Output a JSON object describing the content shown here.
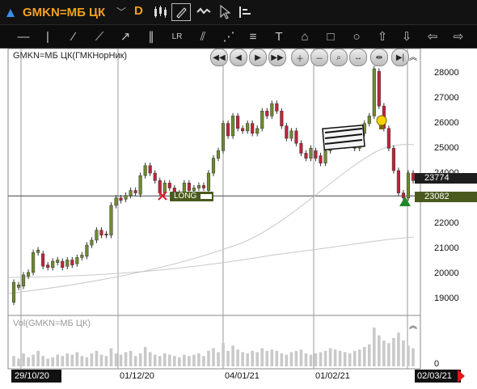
{
  "toolbar": {
    "instrument_label": "GMKN=МБ ЦК",
    "interval_label": "D"
  },
  "chart": {
    "instrument_title": "GMKN=МБ ЦК(ГМКНорНик)",
    "volume_title": "Vol(GMKN=МБ ЦК)",
    "long_label": "LONG",
    "price_tag_upper": "23774",
    "price_tag_lower": "23082",
    "volume_axis_zero": "0",
    "y_ticks": [
      "28000",
      "27000",
      "26000",
      "25000",
      "24000",
      "23000",
      "22000",
      "21000",
      "20000",
      "19000"
    ],
    "x_ticks": [
      "01/12/20",
      "04/01/21",
      "01/02/21"
    ],
    "start_date": "29/10/20",
    "end_date": "02/03/21",
    "colors": {
      "up": "#6f8a2f",
      "down": "#c0243a",
      "accent": "#f2a21b",
      "tag": "#4a5a1e"
    }
  },
  "chart_data": {
    "type": "candlestick",
    "y_range": [
      18400,
      28300
    ],
    "reference_price": 23082,
    "current_price": 23774,
    "candles": [
      [
        18800,
        19600
      ],
      [
        19400,
        19500
      ],
      [
        19450,
        19900
      ],
      [
        19850,
        20000
      ],
      [
        20000,
        20800
      ],
      [
        20800,
        20900
      ],
      [
        20750,
        20250
      ],
      [
        20300,
        20200
      ],
      [
        20200,
        20450
      ],
      [
        20400,
        20500
      ],
      [
        20450,
        20200
      ],
      [
        20250,
        20500
      ],
      [
        20500,
        20300
      ],
      [
        20350,
        20600
      ],
      [
        20600,
        20700
      ],
      [
        20650,
        21100
      ],
      [
        21100,
        21300
      ],
      [
        21300,
        21700
      ],
      [
        21700,
        21500
      ],
      [
        21550,
        21500
      ],
      [
        21500,
        22700
      ],
      [
        22700,
        23000
      ],
      [
        23000,
        22900
      ],
      [
        22950,
        23100
      ],
      [
        23100,
        23300
      ],
      [
        23300,
        23200
      ],
      [
        23150,
        23900
      ],
      [
        23900,
        24300
      ],
      [
        24300,
        24000
      ],
      [
        24000,
        23700
      ],
      [
        23700,
        23200
      ],
      [
        23200,
        23600
      ],
      [
        23600,
        23400
      ],
      [
        23400,
        23200
      ],
      [
        23200,
        23100
      ],
      [
        23100,
        23600
      ],
      [
        23600,
        23300
      ],
      [
        23300,
        23400
      ],
      [
        23400,
        23500
      ],
      [
        23500,
        23400
      ],
      [
        23300,
        24000
      ],
      [
        24000,
        24600
      ],
      [
        24600,
        24900
      ],
      [
        24900,
        26000
      ],
      [
        26000,
        25500
      ],
      [
        25500,
        26300
      ],
      [
        26300,
        25800
      ],
      [
        25800,
        25700
      ],
      [
        25700,
        26000
      ],
      [
        26000,
        25600
      ],
      [
        25600,
        25800
      ],
      [
        25800,
        26500
      ],
      [
        26500,
        26300
      ],
      [
        26300,
        26800
      ],
      [
        26800,
        26500
      ],
      [
        26500,
        25900
      ],
      [
        25900,
        25400
      ],
      [
        25400,
        25700
      ],
      [
        25700,
        25200
      ],
      [
        25200,
        24800
      ],
      [
        24800,
        24600
      ],
      [
        24600,
        25000
      ],
      [
        24900,
        24600
      ],
      [
        24700,
        24400
      ],
      [
        24400,
        24900
      ],
      [
        24900,
        25300
      ],
      [
        25300,
        25600
      ],
      [
        25500,
        25100
      ],
      [
        25100,
        25400
      ],
      [
        25400,
        25200
      ],
      [
        25200,
        25000
      ],
      [
        25000,
        25600
      ],
      [
        25600,
        26000
      ],
      [
        26000,
        26300
      ],
      [
        26300,
        28200
      ],
      [
        28100,
        26700
      ],
      [
        26700,
        25800
      ],
      [
        25800,
        25000
      ],
      [
        25000,
        24100
      ],
      [
        24100,
        23200
      ],
      [
        23200,
        23000
      ],
      [
        23000,
        24000
      ],
      [
        24000,
        23700
      ]
    ],
    "volumes": [
      8,
      6,
      10,
      7,
      9,
      12,
      8,
      6,
      7,
      9,
      8,
      10,
      9,
      11,
      8,
      7,
      10,
      12,
      9,
      8,
      14,
      10,
      9,
      11,
      12,
      8,
      10,
      15,
      11,
      9,
      8,
      10,
      9,
      8,
      7,
      9,
      8,
      9,
      10,
      8,
      12,
      14,
      11,
      18,
      12,
      16,
      13,
      11,
      10,
      12,
      11,
      14,
      12,
      13,
      12,
      10,
      9,
      11,
      12,
      13,
      10,
      9,
      10,
      11,
      12,
      14,
      13,
      12,
      11,
      10,
      12,
      13,
      15,
      17,
      30,
      24,
      20,
      18,
      22,
      26,
      20,
      16,
      14
    ]
  }
}
